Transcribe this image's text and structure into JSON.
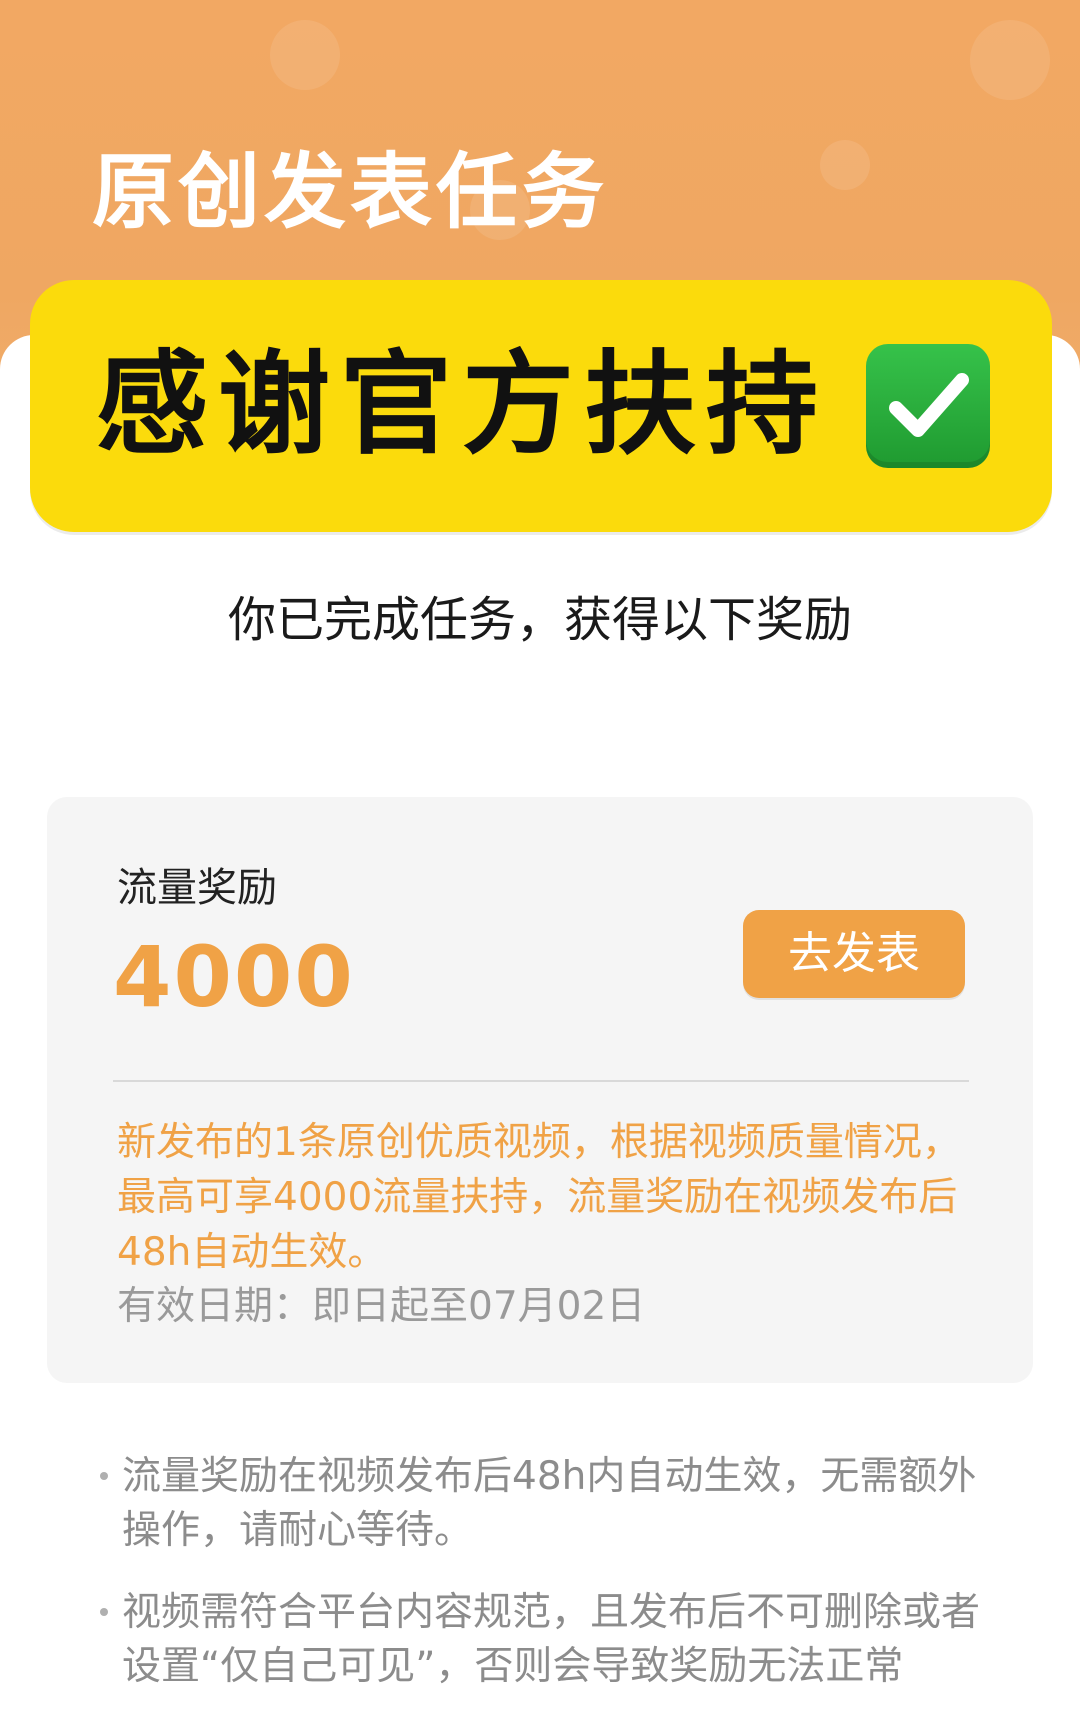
{
  "header": {
    "title": "原创发表任务"
  },
  "banner": {
    "text": "感谢官方扶持",
    "emoji": "check-mark-button-icon"
  },
  "subtitle": "你已完成任务，获得以下奖励",
  "reward": {
    "label": "流量奖励",
    "value": "4000",
    "button_label": "去发表",
    "description": "新发布的1条原创优质视频，根据视频质量情况，最高可享4000流量扶持，流量奖励在视频发布后48h自动生效。",
    "valid_date": "有效日期：即日起至07月02日"
  },
  "notes": [
    "流量奖励在视频发布后48h内自动生效，无需额外操作，请耐心等待。",
    "视频需符合平台内容规范，且发布后不可删除或者设置“仅自己可见”，否则会导致奖励无法正常"
  ],
  "colors": {
    "header_orange": "#f2a863",
    "banner_yellow": "#fbdb0c",
    "accent_orange": "#f0a246",
    "check_green": "#2fb140"
  }
}
